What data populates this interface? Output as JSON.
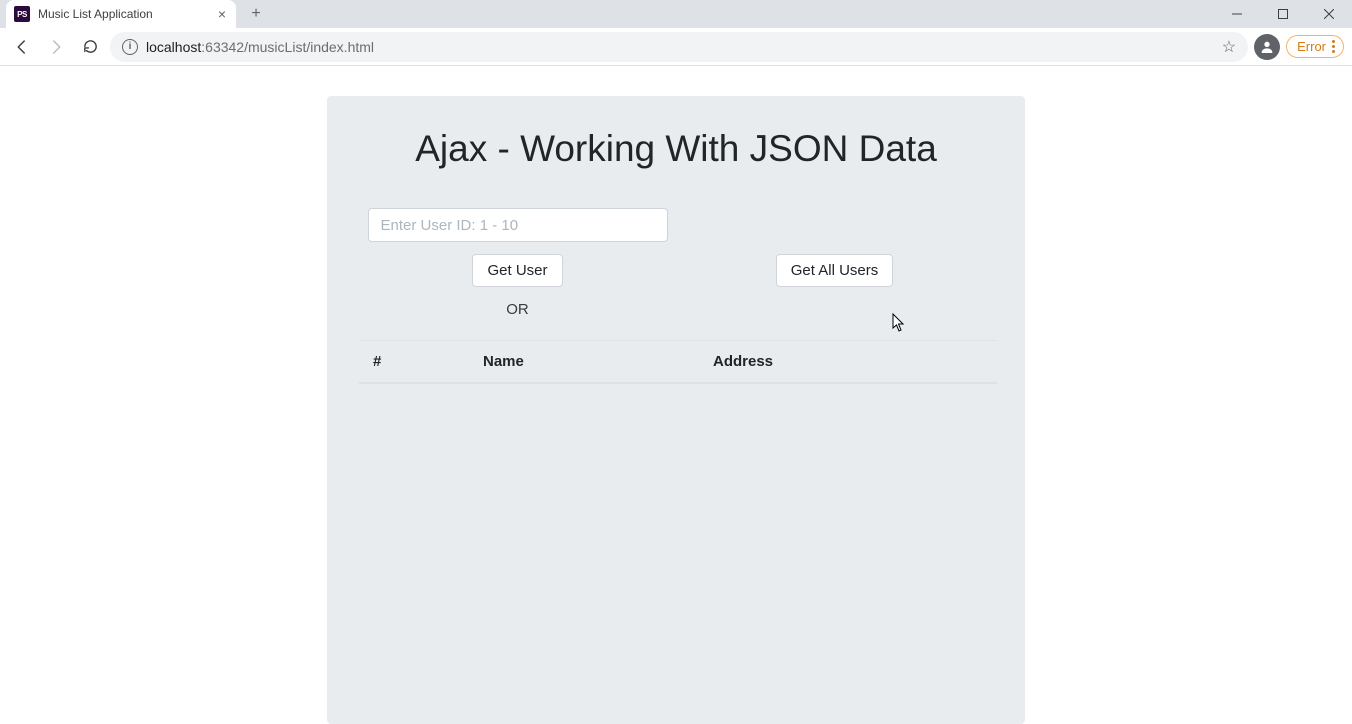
{
  "browser": {
    "tab": {
      "favicon_text": "PS",
      "title": "Music List Application"
    },
    "url_host": "localhost",
    "url_port": ":63342",
    "url_path": "/musicList/index.html",
    "error_label": "Error"
  },
  "page": {
    "heading": "Ajax - Working With JSON Data",
    "user_input": {
      "placeholder": "Enter User ID: 1 - 10",
      "value": ""
    },
    "get_user_button": "Get User",
    "get_all_button": "Get All Users",
    "or_label": "OR",
    "table": {
      "columns": {
        "index": "#",
        "name": "Name",
        "address": "Address"
      },
      "rows": []
    }
  }
}
